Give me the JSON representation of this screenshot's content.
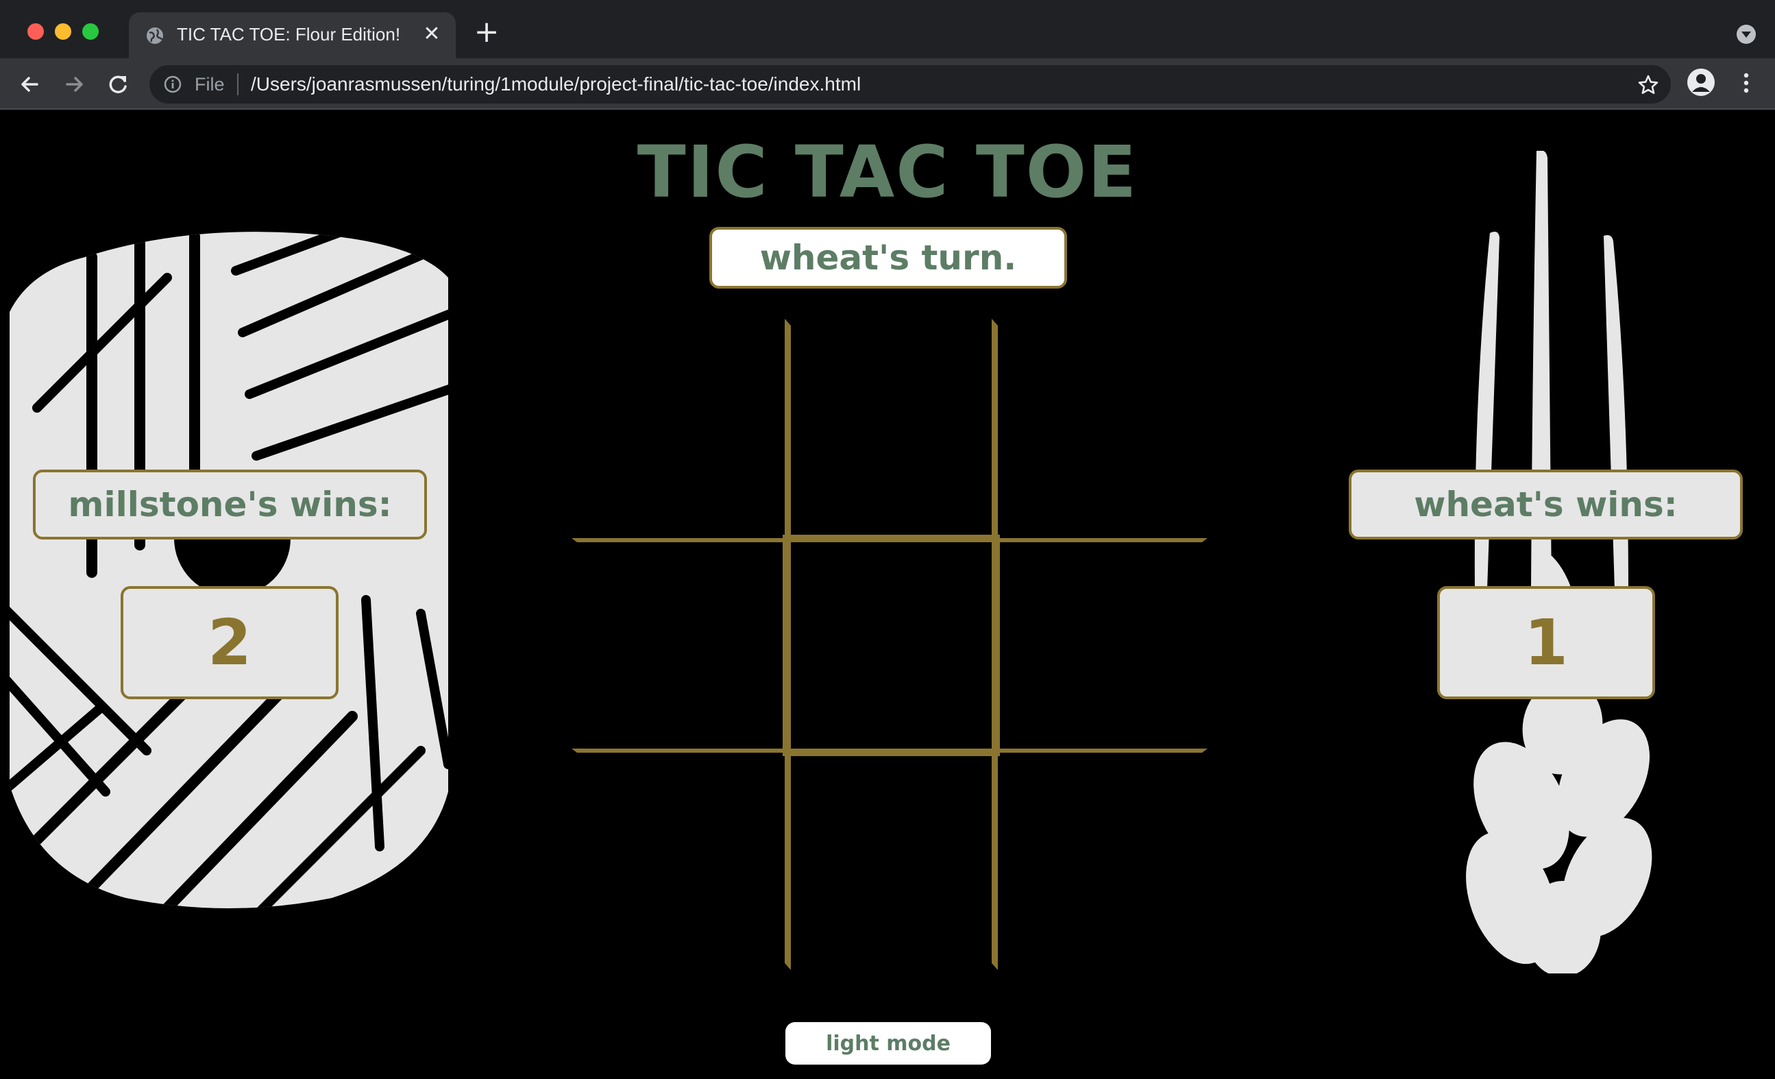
{
  "browser": {
    "tab_title": "TIC TAC TOE: Flour Edition!",
    "scheme_label": "File",
    "url": "/Users/joanrasmussen/turing/1module/project-final/tic-tac-toe/index.html"
  },
  "game": {
    "title": "TIC TAC TOE",
    "turn_message": "wheat's turn.",
    "board_cells": [
      "",
      "",
      "",
      "",
      "",
      "",
      "",
      "",
      ""
    ],
    "millstone": {
      "wins_label": "millstone's wins:",
      "wins": "2"
    },
    "wheat": {
      "wins_label": "wheat's wins:",
      "wins": "1"
    },
    "mode_toggle_label": "light mode"
  },
  "colors": {
    "background": "#000000",
    "title_green": "#5d7d65",
    "gold": "#8a7530",
    "box_fill": "#e6e6e6",
    "icon_light": "#e6e6e6"
  },
  "icons": [
    "globe-icon",
    "close-icon",
    "plus-icon",
    "back-arrow-icon",
    "forward-arrow-icon",
    "reload-icon",
    "info-icon",
    "star-icon",
    "profile-icon",
    "menu-dots-icon",
    "millstone-icon",
    "wheat-icon"
  ]
}
